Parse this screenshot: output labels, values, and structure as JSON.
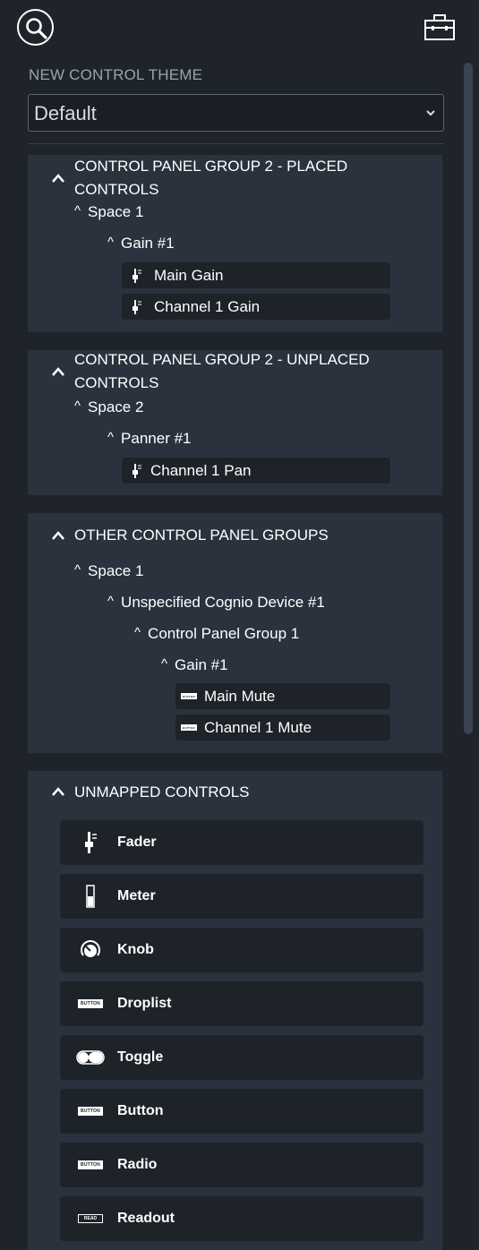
{
  "theme": {
    "label": "NEW CONTROL THEME",
    "selected": "Default"
  },
  "groups": [
    {
      "title": "CONTROL PANEL GROUP 2 - PLACED CONTROLS",
      "space": "Space 1",
      "component": "Gain #1",
      "controls": [
        "Main Gain",
        "Channel 1 Gain"
      ]
    },
    {
      "title": "CONTROL PANEL GROUP 2 - UNPLACED CONTROLS",
      "space": "Space 2",
      "component": "Panner #1",
      "controls": [
        "Channel 1 Pan"
      ]
    },
    {
      "title": "OTHER CONTROL PANEL GROUPS",
      "space": "Space 1",
      "device": "Unspecified Cognio Device #1",
      "panel_group": "Control Panel Group 1",
      "component": "Gain #1",
      "controls": [
        "Main Mute",
        "Channel 1 Mute"
      ]
    }
  ],
  "unmapped": {
    "title": "UNMAPPED CONTROLS",
    "items": [
      {
        "label": "Fader",
        "icon": "fader-icon"
      },
      {
        "label": "Meter",
        "icon": "meter-icon"
      },
      {
        "label": "Knob",
        "icon": "knob-icon"
      },
      {
        "label": "Droplist",
        "icon": "button-badge-icon"
      },
      {
        "label": "Toggle",
        "icon": "toggle-icon"
      },
      {
        "label": "Button",
        "icon": "button-badge-icon"
      },
      {
        "label": "Radio",
        "icon": "button-badge-icon"
      },
      {
        "label": "Readout",
        "icon": "readout-icon"
      }
    ],
    "badge_text": "BUTTON",
    "readout_badge_text": "READ"
  },
  "colors": {
    "background": "#1f242b",
    "panel": "#2a323d",
    "item": "#1e2329",
    "text": "#ffffff",
    "muted": "#9aa3ad"
  }
}
